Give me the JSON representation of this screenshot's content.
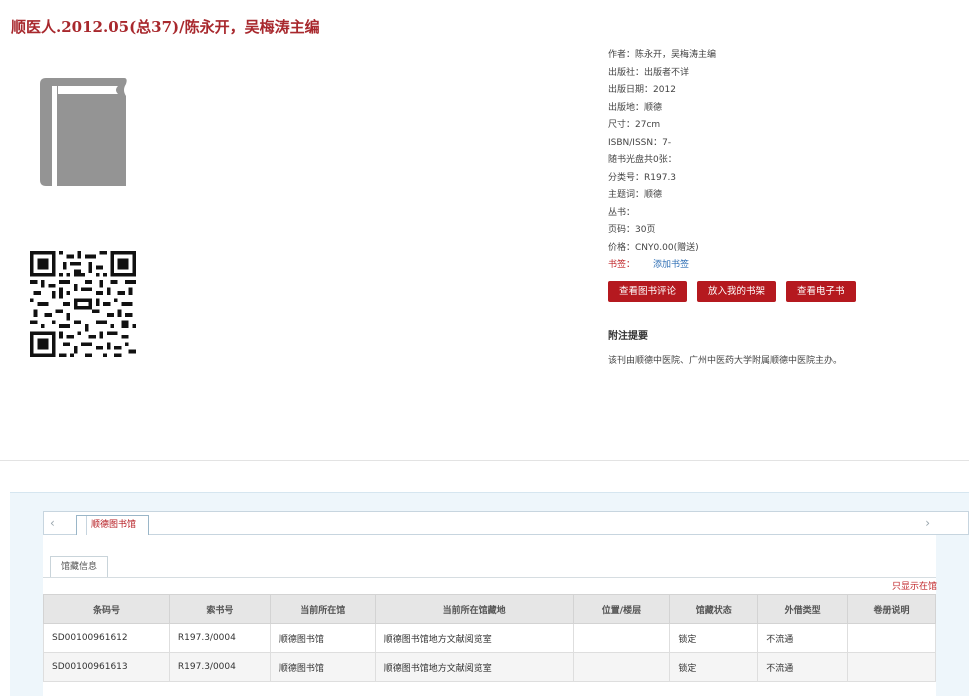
{
  "book": {
    "title": "顺医人.2012.05(总37)/陈永开，吴梅涛主编"
  },
  "metadata": [
    {
      "label": "作者：",
      "value": "陈永开，吴梅涛主编"
    },
    {
      "label": "出版社：",
      "value": "出版者不详"
    },
    {
      "label": "出版日期：",
      "value": "2012"
    },
    {
      "label": "出版地：",
      "value": "顺德"
    },
    {
      "label": "尺寸：",
      "value": "27cm"
    },
    {
      "label": "ISBN/ISSN：",
      "value": "7-"
    },
    {
      "label": "随书光盘共0张：",
      "value": ""
    },
    {
      "label": "分类号：",
      "value": "R197.3"
    },
    {
      "label": "主题词：",
      "value": "顺德"
    },
    {
      "label": "丛书：",
      "value": ""
    },
    {
      "label": "页码：",
      "value": "30页"
    },
    {
      "label": "价格：",
      "value": "CNY0.00(赠送)"
    }
  ],
  "bookmark": {
    "label": "书签：",
    "link": "添加书签"
  },
  "actions": {
    "review": "查看图书评论",
    "shelf": "放入我的书架",
    "ebook": "查看电子书"
  },
  "notes": {
    "heading": "附注提要",
    "text": "该刊由顺德中医院、广州中医药大学附属顺德中医院主办。"
  },
  "library_tab": {
    "label": "顺德图书馆",
    "left_arrow": "‹",
    "right_arrow": "›"
  },
  "holdings": {
    "subtab": "馆藏信息",
    "only_show": "只显示在馆",
    "columns": [
      "条码号",
      "索书号",
      "当前所在馆",
      "当前所在馆藏地",
      "位置/楼层",
      "馆藏状态",
      "外借类型",
      "卷册说明"
    ],
    "rows": [
      [
        "SD00100961612",
        "R197.3/0004",
        "顺德图书馆",
        "顺德图书馆地方文献阅览室",
        "",
        "锁定",
        "不流通",
        ""
      ],
      [
        "SD00100961613",
        "R197.3/0004",
        "顺德图书馆",
        "顺德图书馆地方文献阅览室",
        "",
        "锁定",
        "不流通",
        ""
      ]
    ]
  },
  "colors": {
    "accent": "#b5191f",
    "title": "#a8282d",
    "link": "#2f6fb5"
  }
}
